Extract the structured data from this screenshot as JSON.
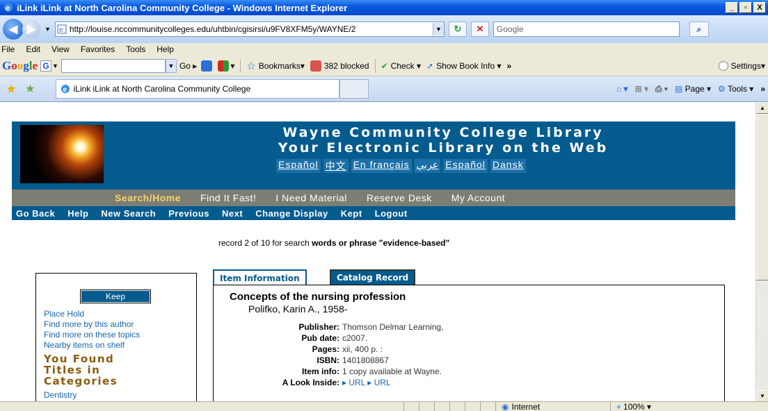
{
  "window": {
    "title": "iLink iLink at North Carolina Community College - Windows Internet Explorer",
    "buttons": [
      "_",
      "▫",
      "X"
    ]
  },
  "address": {
    "url": "http://louise.nccommunitycolleges.edu/uhtbin/cgisirsi/u9FV8XFM5y/WAYNE/2",
    "search_placeholder": "Google"
  },
  "menu": [
    "File",
    "Edit",
    "View",
    "Favorites",
    "Tools",
    "Help"
  ],
  "google_toolbar": {
    "logo": "Google",
    "go": "Go",
    "bookmarks": "Bookmarks▾",
    "blocked": "382 blocked",
    "check": "Check ▾",
    "book_info": "Show Book Info ▾",
    "more": "»",
    "settings": "Settings▾"
  },
  "tabbar": {
    "tab_title": "iLink iLink at North Carolina Community College",
    "page": "Page ▾",
    "tools": "Tools ▾",
    "more": "»"
  },
  "library": {
    "title_line1": "Wayne Community College Library",
    "title_line2": "Your Electronic Library on the Web",
    "languages": [
      "Español",
      "中文",
      "En français",
      "عربي",
      "Español",
      "Dansk"
    ],
    "nav1": [
      "Search/Home",
      "Find It Fast!",
      "I Need Material",
      "Reserve Desk",
      "My Account"
    ],
    "nav2": [
      "Go Back",
      "Help",
      "New Search",
      "Previous",
      "Next",
      "Change Display",
      "Kept",
      "Logout"
    ],
    "record_prefix": "record 2 of 10 for search ",
    "record_query": "words or phrase \"evidence-based\""
  },
  "sidebar": {
    "keep": "Keep",
    "links": [
      "Place Hold",
      "Find more by this author",
      "Find more on these topics",
      "Nearby items on shelf"
    ],
    "found_line1": "You Found",
    "found_line2": "Titles in",
    "found_line3": "Categories",
    "category": "Dentistry"
  },
  "record": {
    "tab_item": "Item Information",
    "tab_catalog": "Catalog Record",
    "title": "Concepts of the nursing profession",
    "author": "Polifko, Karin A., 1958-",
    "fields": [
      {
        "label": "Publisher:",
        "value": "Thomson Delmar Learning,"
      },
      {
        "label": "Pub date:",
        "value": "c2007."
      },
      {
        "label": "Pages:",
        "value": "xii, 400 p. :"
      },
      {
        "label": "ISBN:",
        "value": "1401808867"
      },
      {
        "label": "Item info:",
        "value": "1 copy available at Wayne."
      },
      {
        "label": "A Look Inside:",
        "value": "▸ URL  ▸ URL"
      }
    ]
  },
  "status": {
    "zone": "Internet",
    "zoom": "100%"
  }
}
